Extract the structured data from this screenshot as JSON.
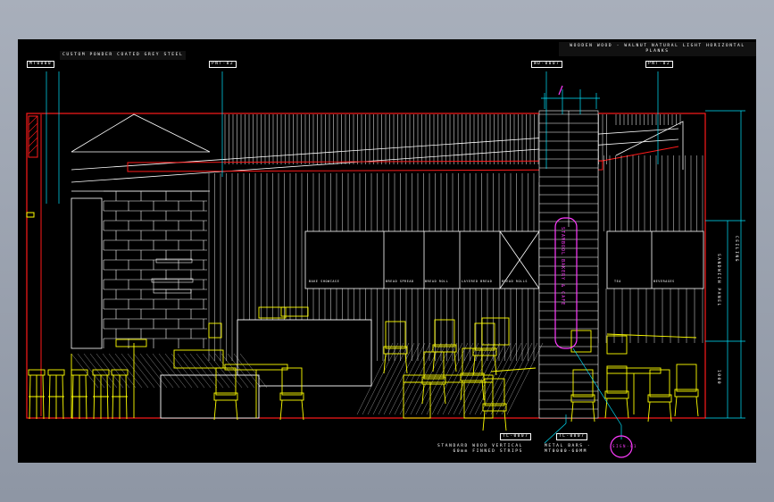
{
  "notes": {
    "top_left": "CUSTOM\nPOWDER\nCOATED GREY\nSTEEL",
    "top_right": "WOODEN WOOD -\nWALNUT\nNATURAL\nLIGHT\nHORIZONTAL\nPLANKS"
  },
  "tags": {
    "t1": "MT0000",
    "t2": "PNT-02",
    "t3": "WD-0007",
    "t4": "PNT-02",
    "t5": "TL-0007",
    "t6": "TL-0007"
  },
  "bottom_notes": {
    "left_line1": "STANDARD WOOD VERTICAL",
    "left_line2": "60mm FINNED STRIPS",
    "right_line1": "METAL BARS -",
    "right_line2": "MT0000-60MM"
  },
  "dimensions": {
    "ceiling": "CEILING",
    "middle": "SANDWICH PANEL",
    "lower": "1000"
  },
  "sign_text": "STAMBOOL BAKERY & CAFE",
  "callout": "SIGN-01",
  "window_labels": [
    "BAKE SHOWCASE",
    "BREAD SPREAD",
    "BREAD ROLL",
    "LAYERED BREAD",
    "BREAD ROLLS",
    "TEA",
    "BEVERAGES"
  ],
  "colors": {
    "outline": "#ffffff",
    "frame": "#ff1a1a",
    "furniture": "#ffff00",
    "dimension": "#00e5ff",
    "sign": "#ff3bff"
  }
}
